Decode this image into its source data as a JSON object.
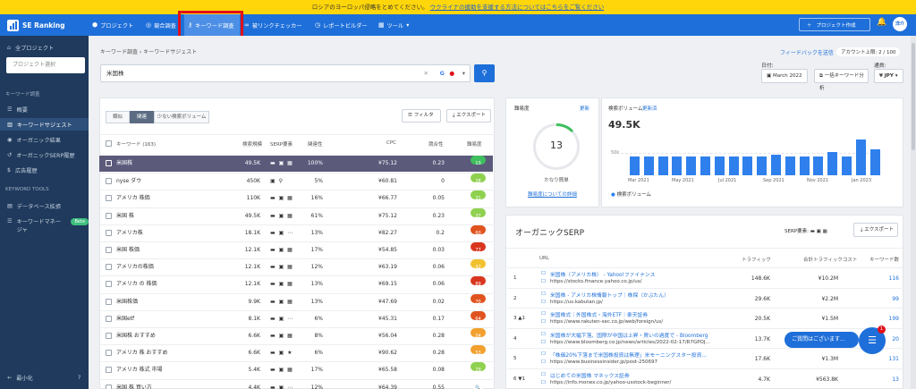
{
  "banner": {
    "text": "ロシアのヨーロッパ侵略をとめてください。",
    "link": "ウクライナの援助を支援する方法についてはこちらをご覧ください"
  },
  "brand": {
    "name": "SE Ranking"
  },
  "topnav": {
    "items": [
      {
        "icon": "cube",
        "label": "プロジェクト"
      },
      {
        "icon": "target",
        "label": "競合調査"
      },
      {
        "icon": "key",
        "label": "キーワード調査"
      },
      {
        "icon": "link",
        "label": "被リンクチェッカー"
      },
      {
        "icon": "clock",
        "label": "レポートビルダー"
      },
      {
        "icon": "grid",
        "label": "ツール"
      }
    ],
    "add_project": "プロジェクト作成",
    "avatar": "洋介"
  },
  "sidebar": {
    "all_projects": "全プロジェクト",
    "project_placeholder": "プロジェクト選択",
    "section1": "キーワード調査",
    "items": [
      {
        "label": "概要"
      },
      {
        "label": "キーワードサジェスト"
      },
      {
        "label": "オーガニック結果"
      },
      {
        "label": "オーガニックSERP履歴"
      },
      {
        "label": "広告履歴"
      }
    ],
    "section2": "KEYWORD TOOLS",
    "tools": [
      {
        "label": "データベース拡張"
      },
      {
        "label": "キーワードマネージャ",
        "badge": "Beta"
      }
    ],
    "collapse": "最小化"
  },
  "breadcrumb": {
    "root": "キーワード調査",
    "current": "キーワードサジェスト"
  },
  "feedback": "フィードバックを送信",
  "credits": "アカウント上限: 2 / 100",
  "search": {
    "value": "米国株",
    "search_engine": "G"
  },
  "filters": {
    "date_label": "日付:",
    "date_value": "March 2022",
    "range_btn": "一括キーワード分析",
    "currency_label": "通貨:",
    "currency_value": "¥ JPY"
  },
  "table": {
    "tabs": [
      "類似",
      "関連",
      "少ない検索ボリューム"
    ],
    "filter_btn": "フィルタ",
    "export_btn": "エクスポート",
    "headers": {
      "keyword": "キーワード (163)",
      "volume": "検索規模",
      "serp": "SERP要素",
      "relevance": "関連性",
      "cpc": "CPC",
      "competition": "競合性",
      "difficulty": "難易度"
    },
    "rows": [
      {
        "kw": "米国株",
        "vol": "49.5K",
        "serp": "▬ ▣ ▦",
        "rel": "100%",
        "cpc": "¥75.12",
        "comp": "0.23",
        "kd": "13",
        "kdc": "#3fbf5f"
      },
      {
        "kw": "nyse ダウ",
        "vol": "450K",
        "serp": "▣ ⚲",
        "rel": "5%",
        "cpc": "¥60.81",
        "comp": "0",
        "kd": "28",
        "kdc": "#8fd14f"
      },
      {
        "kw": "アメリカ 株価",
        "vol": "110K",
        "serp": "▬ ▣ ▦",
        "rel": "16%",
        "cpc": "¥66.77",
        "comp": "0.05",
        "kd": "31",
        "kdc": "#8fd14f"
      },
      {
        "kw": "米国 株",
        "vol": "49.5K",
        "serp": "▬ ▣ ▦",
        "rel": "61%",
        "cpc": "¥75.12",
        "comp": "0.23",
        "kd": "37",
        "kdc": "#8fd14f"
      },
      {
        "kw": "アメリカ株",
        "vol": "18.1K",
        "serp": "▬ ▣ ⋯",
        "rel": "13%",
        "cpc": "¥82.27",
        "comp": "0.2",
        "kd": "60",
        "kdc": "#e0531f"
      },
      {
        "kw": "米国 株価",
        "vol": "12.1K",
        "serp": "▬ ▣ ▦",
        "rel": "17%",
        "cpc": "¥54.85",
        "comp": "0.03",
        "kd": "77",
        "kdc": "#d9361f"
      },
      {
        "kw": "アメリカの株価",
        "vol": "12.1K",
        "serp": "▬ ▣ ▦",
        "rel": "12%",
        "cpc": "¥63.19",
        "comp": "0.06",
        "kd": "42",
        "kdc": "#f2c12e"
      },
      {
        "kw": "アメリカ の 株価",
        "vol": "12.1K",
        "serp": "▬ ▣ ▦",
        "rel": "13%",
        "cpc": "¥69.15",
        "comp": "0.06",
        "kd": "89",
        "kdc": "#d9361f"
      },
      {
        "kw": "米国株価",
        "vol": "9.9K",
        "serp": "▬ ▣ ▦",
        "rel": "13%",
        "cpc": "¥47.69",
        "comp": "0.02",
        "kd": "70",
        "kdc": "#e0531f"
      },
      {
        "kw": "米国etf",
        "vol": "8.1K",
        "serp": "▬ ▣ ⋯",
        "rel": "6%",
        "cpc": "¥45.31",
        "comp": "0.17",
        "kd": "64",
        "kdc": "#e0531f"
      },
      {
        "kw": "米国株 おすすめ",
        "vol": "6.6K",
        "serp": "▬ ▣ ▦",
        "rel": "8%",
        "cpc": "¥56.04",
        "comp": "0.28",
        "kd": "54",
        "kdc": "#f2a02e"
      },
      {
        "kw": "アメリカ 株 おすすめ",
        "vol": "6.6K",
        "serp": "▬ ▣ ★",
        "rel": "6%",
        "cpc": "¥90.62",
        "comp": "0.28",
        "kd": "53",
        "kdc": "#f2a02e"
      },
      {
        "kw": "アメリカ 株式 市場",
        "vol": "5.4K",
        "serp": "▬ ▣ ▦",
        "rel": "17%",
        "cpc": "¥65.58",
        "comp": "0.08",
        "kd": "29",
        "kdc": "#8fd14f"
      },
      {
        "kw": "米国 株 買い方",
        "vol": "4.4K",
        "serp": "▬ ▣ ⋯",
        "rel": "12%",
        "cpc": "¥64.39",
        "comp": "0.55",
        "kd": "🔍",
        "kdc": "#ffffff"
      }
    ]
  },
  "kd_card": {
    "title": "難易度",
    "refresh": "更新",
    "value": "13",
    "label": "かなり簡単",
    "more": "難易度についての詳細"
  },
  "volume_card": {
    "title": "検索ボリューム",
    "refresh": "更新済",
    "total": "49.5K",
    "legend": "検索ボリューム"
  },
  "chart_data": {
    "type": "bar",
    "ylabel_ticks": [
      "50k"
    ],
    "x_tick_labels": [
      "Mar 2021",
      "May 2021",
      "Jul 2021",
      "Sep 2021",
      "Nov 2021",
      "Jan 2023"
    ],
    "values": [
      40,
      40,
      40,
      40,
      40,
      40,
      40,
      40,
      40,
      40,
      44,
      40,
      40,
      40,
      48,
      40,
      75,
      55
    ],
    "ylim": [
      0,
      90
    ]
  },
  "serp": {
    "title": "オーガニックSERP",
    "features_label": "SERP要素:",
    "export": "エクスポート",
    "headers": {
      "url": "URL",
      "traffic": "トラフィック",
      "cost": "合計トラフィックコスト",
      "keywords": "キーワード数"
    },
    "rows": [
      {
        "pos": "1",
        "title": "米国株（アメリカ株） - Yahoo!ファイナンス",
        "url": "https://stocks.finance.yahoo.co.jp/us/",
        "traffic": "148.6K",
        "cost": "¥10.2M",
        "kw": "116"
      },
      {
        "pos": "2",
        "title": "米国株 - アメリカ株情報トップ｜株探（かぶたん）",
        "url": "https://us.kabutan.jp/",
        "traffic": "29.6K",
        "cost": "¥2.2M",
        "kw": "99"
      },
      {
        "pos": "3 ▲1",
        "title": "米国株式｜外国株式・海外ETF｜楽天証券",
        "url": "https://www.rakuten-sec.co.jp/web/foreign/us/",
        "traffic": "20.5K",
        "cost": "¥1.5M",
        "kw": "199"
      },
      {
        "pos": "4",
        "title": "米国株が大幅下落、国際が中国は上昇・買いの過度で - Bloomberg",
        "url": "https://www.bloomberg.co.jp/news/articles/2022-02-17/R7GPOJ...",
        "traffic": "13.7K",
        "cost": "",
        "kw": "20"
      },
      {
        "pos": "5",
        "title": "「株価20%下落まで米国株投資は無理」米モーニングスター投資...",
        "url": "https://www.businessinsider.jp/post-250697",
        "traffic": "17.6K",
        "cost": "¥1.3M",
        "kw": "131"
      },
      {
        "pos": "6 ▼1",
        "title": "はじめての米国株 マネックス証券",
        "url": "https://info.monex.co.jp/yahoo-usstock-beginner/",
        "traffic": "4.7K",
        "cost": "¥563.8K",
        "kw": "13"
      }
    ]
  },
  "chat": {
    "pill": "ご質問はございます...",
    "badge": "1"
  }
}
